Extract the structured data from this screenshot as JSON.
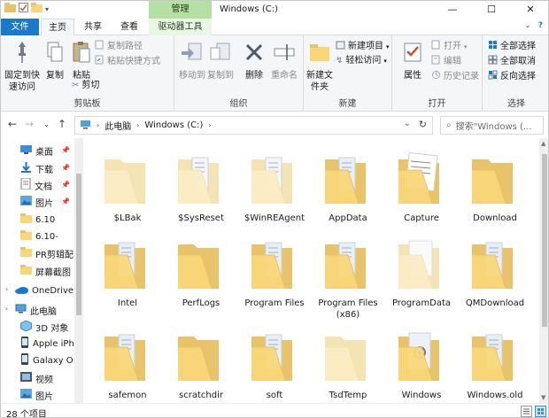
{
  "window": {
    "title": "Windows (C:)",
    "context_tab_group": "管理",
    "minimize_glyph": "—",
    "maximize_glyph": "☐",
    "close_glyph": "✕"
  },
  "tabs": {
    "file": "文件",
    "home": "主页",
    "share": "共享",
    "view": "查看",
    "drive_tools": "驱动器工具"
  },
  "ribbon": {
    "clipboard": {
      "group_label": "剪贴板",
      "pin_quick_access": "固定到快速访问",
      "copy": "复制",
      "paste": "粘贴",
      "copy_path": "复制路径",
      "paste_shortcut": "粘贴快捷方式",
      "cut": "剪切"
    },
    "organize": {
      "group_label": "组织",
      "move_to": "移动到",
      "copy_to": "复制到",
      "delete": "删除",
      "rename": "重命名"
    },
    "new": {
      "group_label": "新建",
      "new_folder": "新建文件夹",
      "new_item": "新建项目",
      "easy_access": "轻松访问"
    },
    "open": {
      "group_label": "打开",
      "properties": "属性",
      "open": "打开",
      "edit": "编辑",
      "history": "历史记录"
    },
    "select": {
      "group_label": "选择",
      "select_all": "全部选择",
      "select_none": "全部取消",
      "invert": "反向选择"
    }
  },
  "navbar": {
    "path": [
      "此电脑",
      "Windows (C:)"
    ],
    "search_placeholder": "搜索\"Windows (..."
  },
  "navpane": {
    "items": [
      {
        "label": "桌面",
        "icon": "desktop-icon",
        "pinned": true
      },
      {
        "label": "下载",
        "icon": "download-icon",
        "pinned": true
      },
      {
        "label": "文档",
        "icon": "documents-icon",
        "pinned": true
      },
      {
        "label": "图片",
        "icon": "pictures-icon",
        "pinned": true
      },
      {
        "label": "6.10",
        "icon": "folder-icon",
        "pinned": false
      },
      {
        "label": "6.10-",
        "icon": "folder-icon",
        "pinned": false
      },
      {
        "label": "PR剪辑配",
        "icon": "folder-icon",
        "pinned": false
      },
      {
        "label": "屏幕截图",
        "icon": "folder-icon",
        "pinned": false
      },
      {
        "label": "OneDrive",
        "icon": "onedrive-icon",
        "pinned": false
      },
      {
        "label": "此电脑",
        "icon": "this-pc-icon",
        "pinned": false
      },
      {
        "label": "3D 对象",
        "icon": "3d-objects-icon",
        "pinned": false
      },
      {
        "label": "Apple iPh",
        "icon": "phone-icon",
        "pinned": false
      },
      {
        "label": "Galaxy O",
        "icon": "phone-icon",
        "pinned": false
      },
      {
        "label": "视频",
        "icon": "videos-icon",
        "pinned": false
      },
      {
        "label": "图片",
        "icon": "pictures-icon",
        "pinned": false
      }
    ]
  },
  "folders": [
    {
      "name": "$LBak",
      "variant": "faded"
    },
    {
      "name": "$SysReset",
      "variant": "faded-doc"
    },
    {
      "name": "$WinREAgent",
      "variant": "faded-doc"
    },
    {
      "name": "AppData",
      "variant": "doc"
    },
    {
      "name": "Capture",
      "variant": "capture"
    },
    {
      "name": "Download",
      "variant": "plain"
    },
    {
      "name": "Intel",
      "variant": "doc"
    },
    {
      "name": "PerfLogs",
      "variant": "plain"
    },
    {
      "name": "Program Files",
      "variant": "doc"
    },
    {
      "name": "Program Files (x86)",
      "variant": "doc"
    },
    {
      "name": "ProgramData",
      "variant": "faded-white"
    },
    {
      "name": "QMDownload",
      "variant": "doc"
    },
    {
      "name": "safemon",
      "variant": "doc"
    },
    {
      "name": "scratchdir",
      "variant": "plain"
    },
    {
      "name": "soft",
      "variant": "doc"
    },
    {
      "name": "TsdTemp",
      "variant": "faded"
    },
    {
      "name": "Windows",
      "variant": "gear"
    },
    {
      "name": "Windows.old",
      "variant": "doc"
    }
  ],
  "status": {
    "count": "28 个项目"
  },
  "colors": {
    "file_tab": "#1979ca",
    "context_tab": "#b6dfa4",
    "folder_back": "#e9c36a",
    "folder_front": "#f9d779"
  }
}
